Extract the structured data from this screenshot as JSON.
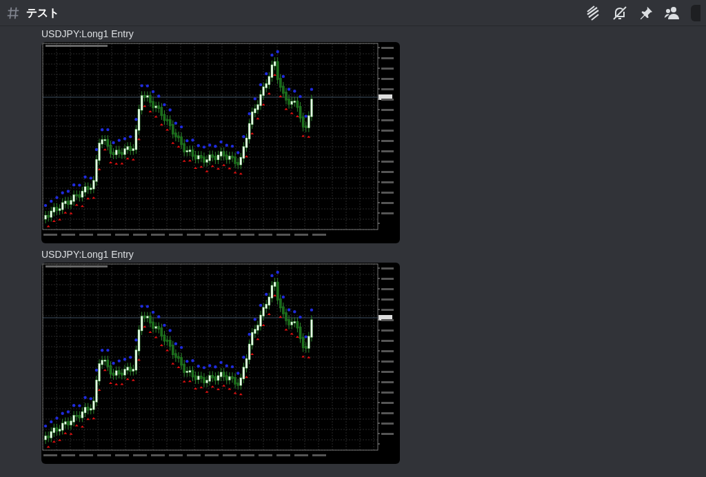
{
  "channel": {
    "name": "テスト"
  },
  "messages": [
    {
      "caption": "USDJPY:Long1 Entry"
    },
    {
      "caption": "USDJPY:Long1 Entry"
    }
  ]
}
